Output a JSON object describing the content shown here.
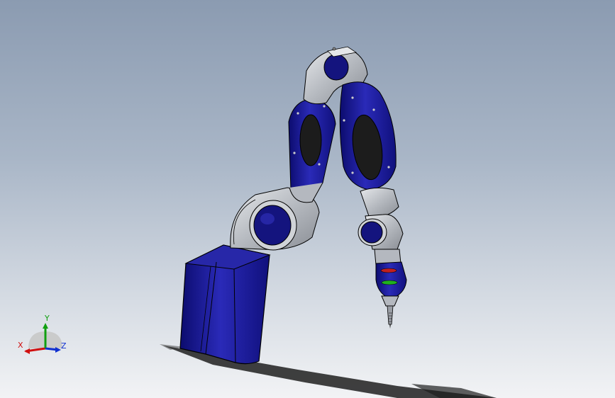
{
  "viewport": {
    "background_top": "#8b9bb1",
    "background_bottom": "#f2f3f5"
  },
  "model": {
    "body_color": "#1a1aa0",
    "joint_color": "#b4b8bf",
    "window_color": "#1c1c1c",
    "led_red": "#c02020",
    "led_green": "#20b020"
  },
  "triad": {
    "x_label": "X",
    "y_label": "Y",
    "z_label": "Z",
    "x_color": "#d01010",
    "y_color": "#10a010",
    "z_color": "#1030d0"
  }
}
